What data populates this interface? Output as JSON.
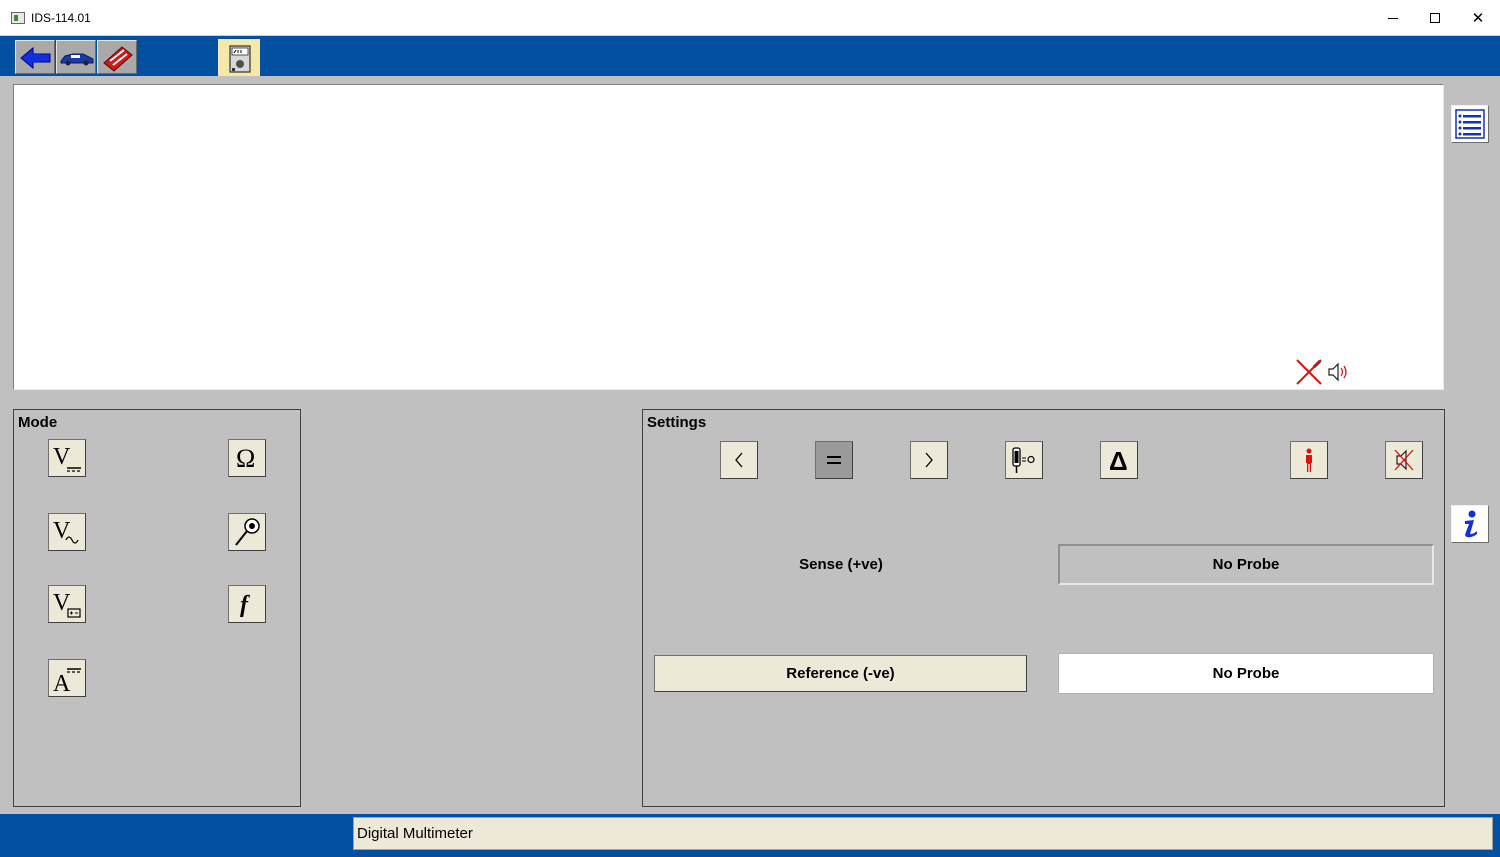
{
  "window": {
    "title": "IDS-114.01",
    "close_glyph": "✕"
  },
  "toolbar": {
    "buttons": [
      "back-arrow-icon",
      "vehicle-icon",
      "toolbox-icon",
      "multimeter-icon"
    ]
  },
  "mode_panel": {
    "title": "Mode",
    "buttons": [
      {
        "name": "dc-voltage",
        "glyph": "V"
      },
      {
        "name": "resistance",
        "glyph": "Ω"
      },
      {
        "name": "ac-voltage",
        "glyph": "V"
      },
      {
        "name": "diode-continuity",
        "glyph": ""
      },
      {
        "name": "battery-voltage",
        "glyph": "V"
      },
      {
        "name": "frequency",
        "glyph": "f"
      },
      {
        "name": "dc-current",
        "glyph": "A"
      }
    ]
  },
  "settings_panel": {
    "title": "Settings",
    "sense_label": "Sense (+ve)",
    "sense_probe": "No Probe",
    "reference_label": "Reference (-ve)",
    "reference_probe": "No Probe",
    "equals_glyph": "=",
    "delta_glyph": "Δ"
  },
  "status": {
    "text": "Digital Multimeter"
  },
  "colors": {
    "frame_blue": "#0450a0",
    "panel_grey": "#c0c0c0",
    "button_beige": "#ede9d8",
    "accent_red": "#e01010"
  }
}
